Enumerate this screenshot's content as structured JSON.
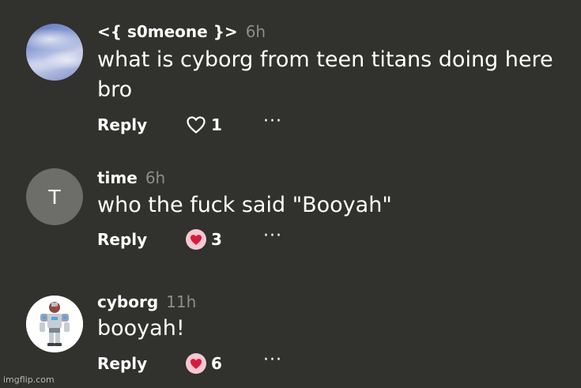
{
  "comments": [
    {
      "username": "<{ s0meone }>",
      "time": "6h",
      "text": "what is cyborg from teen titans doing here bro",
      "reply_label": "Reply",
      "likes": "1",
      "liked": false,
      "more_label": "···",
      "avatar": "sky-clouds-picture"
    },
    {
      "username": "time",
      "time": "6h",
      "text": "who the fuck said \"Booyah\"",
      "reply_label": "Reply",
      "likes": "3",
      "liked": true,
      "more_label": "···",
      "avatar_letter": "T"
    },
    {
      "username": "cyborg",
      "time": "11h",
      "text": "booyah!",
      "reply_label": "Reply",
      "likes": "6",
      "liked": true,
      "more_label": "···",
      "avatar": "cyborg-character-picture"
    }
  ],
  "colors": {
    "background": "#31312e",
    "timestamp": "#8d8d88",
    "heart_filled": "#d81b3c",
    "heart_bg": "#f6c9d2"
  },
  "icons": {
    "like_outline": "heart-outline-icon",
    "like_filled": "heart-filled-icon",
    "more": "more-options-icon"
  },
  "watermark": "imgflip.com"
}
